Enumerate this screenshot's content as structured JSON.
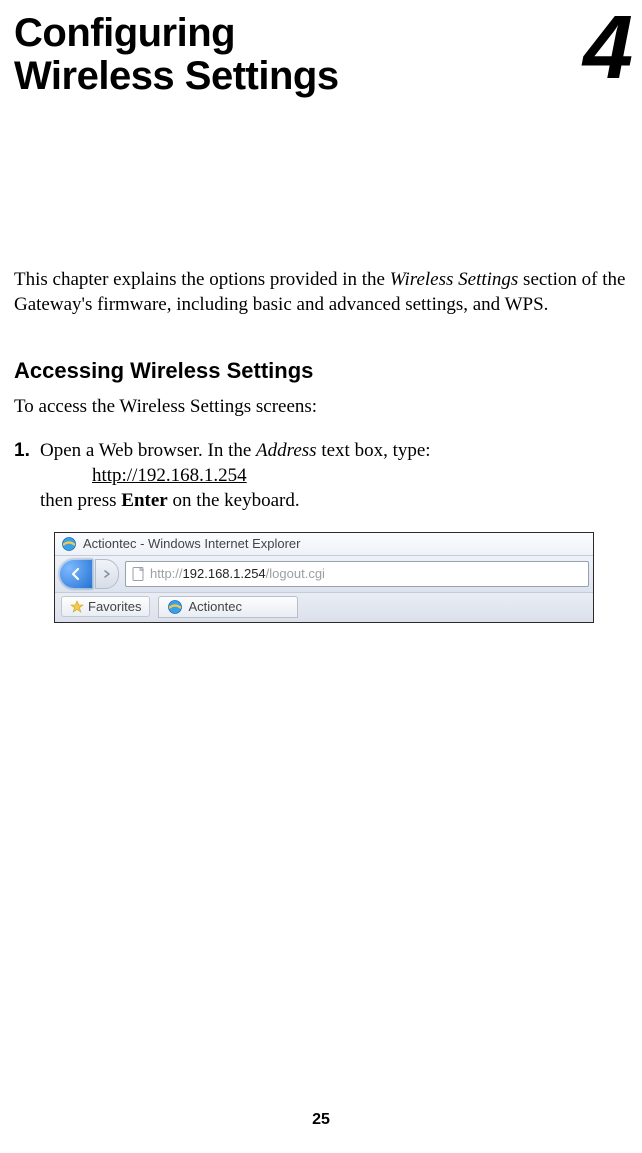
{
  "chapter": {
    "title_line1": "Configuring",
    "title_line2": "Wireless Settings",
    "number": "4"
  },
  "intro": {
    "pre": "This chapter explains the options provided in the ",
    "italic": "Wireless Settings",
    "post": " section of the Gateway's firmware, including basic and advanced settings, and WPS."
  },
  "section": {
    "heading": "Accessing Wireless Settings",
    "sub": "To access the Wireless Settings screens:"
  },
  "step1": {
    "num": "1.",
    "pre": "Open a Web browser. In the ",
    "italic": "Address",
    "mid": " text box, type:",
    "url": "http://192.168.1.254",
    "post_pre": "then press ",
    "post_bold": "Enter",
    "post_after": " on the keyboard."
  },
  "browser": {
    "title": "Actiontec - Windows Internet Explorer",
    "url_grey_pre": "http://",
    "url_dark": "192.168.1.254",
    "url_grey_post": "/logout.cgi",
    "favorites": "Favorites",
    "tab": "Actiontec"
  },
  "page_number": "25"
}
